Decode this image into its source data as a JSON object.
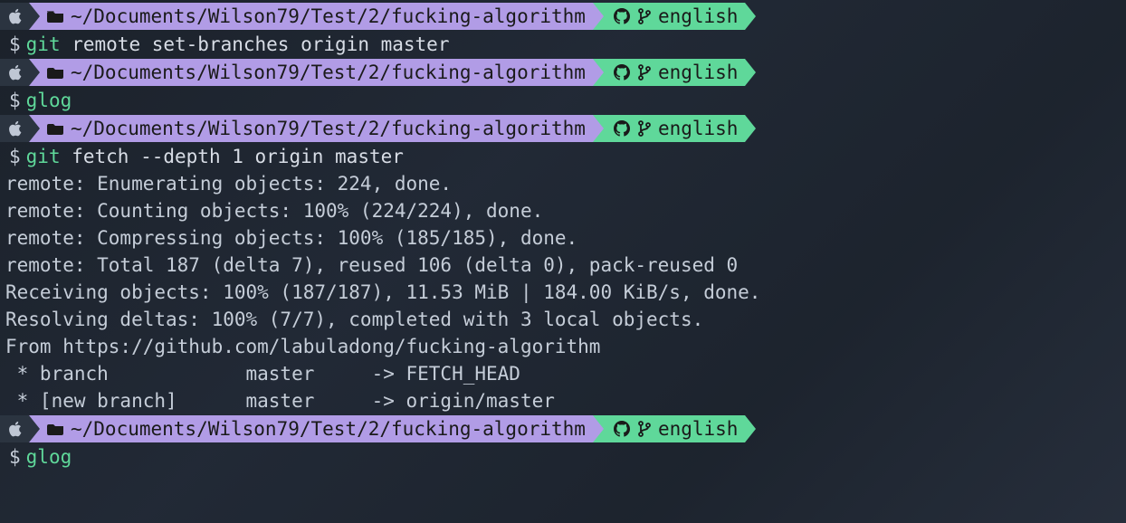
{
  "path": "~/Documents/Wilson79/Test/2/fucking-algorithm",
  "branch": "english",
  "dollar": "$",
  "commands": {
    "c1_git": "git",
    "c1_args": " remote set-branches origin master",
    "c2_full": "glog",
    "c3_git": "git",
    "c3_args": " fetch --depth 1 origin master",
    "c4_full": "glog"
  },
  "output": {
    "l1": "remote: Enumerating objects: 224, done.",
    "l2": "remote: Counting objects: 100% (224/224), done.",
    "l3": "remote: Compressing objects: 100% (185/185), done.",
    "l4": "remote: Total 187 (delta 7), reused 106 (delta 0), pack-reused 0",
    "l5": "Receiving objects: 100% (187/187), 11.53 MiB | 184.00 KiB/s, done.",
    "l6": "Resolving deltas: 100% (7/7), completed with 3 local objects.",
    "l7": "From https://github.com/labuladong/fucking-algorithm",
    "l8": " * branch            master     -> FETCH_HEAD",
    "l9": " * [new branch]      master     -> origin/master"
  }
}
